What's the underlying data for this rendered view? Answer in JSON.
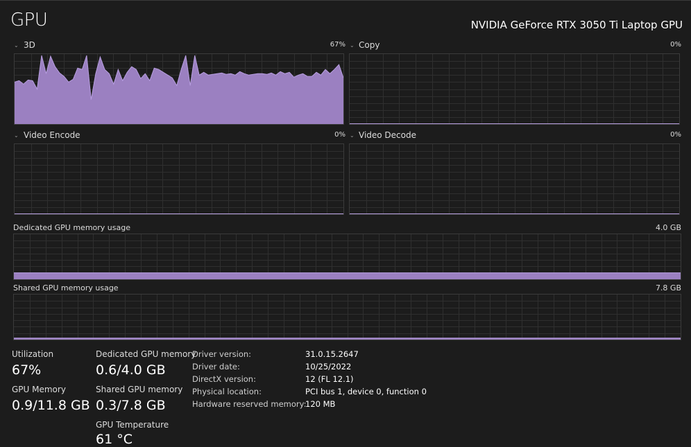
{
  "header": {
    "title": "GPU",
    "gpu_name": "NVIDIA GeForce RTX 3050 Ti Laptop GPU"
  },
  "colors": {
    "accent_fill": "#9b80c1",
    "accent_line": "#b79ee0",
    "grid": "#2f2f2f",
    "border": "#3b3b3b"
  },
  "engines": [
    {
      "label": "3D",
      "percent": "67%"
    },
    {
      "label": "Copy",
      "percent": "0%"
    },
    {
      "label": "Video Encode",
      "percent": "0%"
    },
    {
      "label": "Video Decode",
      "percent": "0%"
    }
  ],
  "chart_data": [
    {
      "type": "area",
      "title": "3D",
      "ylim": [
        0,
        100
      ],
      "y_unit": "%",
      "values": [
        60,
        62,
        57,
        63,
        62,
        50,
        98,
        72,
        97,
        82,
        73,
        68,
        60,
        64,
        80,
        78,
        98,
        35,
        72,
        96,
        78,
        72,
        57,
        78,
        62,
        74,
        82,
        78,
        65,
        72,
        62,
        80,
        78,
        74,
        70,
        66,
        55,
        78,
        98,
        55,
        98,
        70,
        74,
        70,
        71,
        72,
        73,
        71,
        72,
        70,
        75,
        72,
        70,
        71,
        72,
        72,
        71,
        73,
        70,
        75,
        72,
        74,
        67,
        70,
        72,
        68,
        68,
        74,
        70,
        78,
        72,
        78,
        85,
        66
      ],
      "grid": true
    },
    {
      "type": "area",
      "title": "Copy",
      "ylim": [
        0,
        100
      ],
      "values": [],
      "grid": true
    },
    {
      "type": "area",
      "title": "Video Encode",
      "ylim": [
        0,
        100
      ],
      "values": [],
      "grid": true
    },
    {
      "type": "area",
      "title": "Video Decode",
      "ylim": [
        0,
        100
      ],
      "values": [],
      "grid": true
    },
    {
      "type": "area",
      "title": "Dedicated GPU memory usage",
      "ylim": [
        0,
        4.0
      ],
      "y_unit": "GB",
      "max_label": "4.0 GB",
      "level_fraction": 0.15,
      "grid": true
    },
    {
      "type": "area",
      "title": "Shared GPU memory usage",
      "ylim": [
        0,
        7.8
      ],
      "y_unit": "GB",
      "max_label": "7.8 GB",
      "level_fraction": 0.04,
      "grid": true
    }
  ],
  "memory": {
    "dedicated": {
      "label": "Dedicated GPU memory usage",
      "max": "4.0 GB"
    },
    "shared": {
      "label": "Shared GPU memory usage",
      "max": "7.8 GB"
    }
  },
  "stats": {
    "utilization": {
      "label": "Utilization",
      "value": "67%"
    },
    "gpu_memory": {
      "label": "GPU Memory",
      "value": "0.9/11.8 GB"
    },
    "dedicated_memory": {
      "label": "Dedicated GPU memory",
      "value": "0.6/4.0 GB"
    },
    "shared_memory": {
      "label": "Shared GPU memory",
      "value": "0.3/7.8 GB"
    },
    "temperature": {
      "label": "GPU Temperature",
      "value": "61 °C"
    }
  },
  "info": [
    {
      "key": "Driver version:",
      "value": "31.0.15.2647"
    },
    {
      "key": "Driver date:",
      "value": "10/25/2022"
    },
    {
      "key": "DirectX version:",
      "value": "12 (FL 12.1)"
    },
    {
      "key": "Physical location:",
      "value": "PCI bus 1, device 0, function 0"
    },
    {
      "key": "Hardware reserved memory:",
      "value": "120 MB"
    }
  ]
}
